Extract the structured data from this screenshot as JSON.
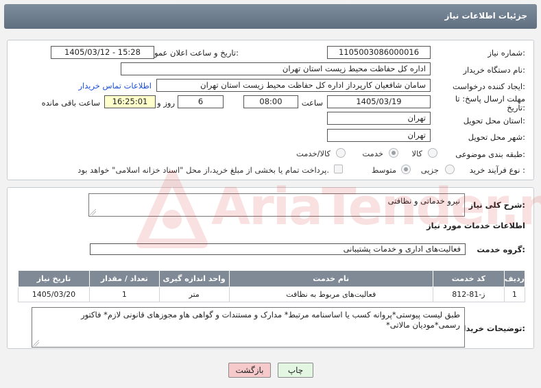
{
  "header": {
    "title": "جزئیات اطلاعات نیاز"
  },
  "form": {
    "need_number_label": "شماره نیاز:",
    "need_number": "1105003086000016",
    "announce_label": "تاریخ و ساعت اعلان عمومی:",
    "announce_value": "1405/03/12 - 15:28",
    "buyer_org_label": "نام دستگاه خریدار:",
    "buyer_org": "اداره کل حفاظت محیط زیست استان تهران",
    "requester_label": "ایجاد کننده درخواست:",
    "requester": "سامان شافعیان کارپرداز اداره کل حفاظت محیط زیست استان تهران",
    "contact_link": "اطلاعات تماس خریدار",
    "deadline_label_1": "مهلت ارسال پاسخ: تا",
    "deadline_label_2": "تاریخ:",
    "deadline_date": "1405/03/19",
    "time_label": "ساعت",
    "deadline_time": "08:00",
    "days_value": "6",
    "days_label": "روز و",
    "remaining_time": "16:25:01",
    "remaining_label": "ساعت باقی مانده",
    "province_label": "استان محل تحویل:",
    "province": "تهران",
    "city_label": "شهر محل تحویل:",
    "city": "تهران",
    "category_label": "طبقه بندی موضوعی:",
    "category_options": [
      "کالا",
      "خدمت",
      "کالا/خدمت"
    ],
    "process_label": "نوع فرآیند خرید :",
    "process_options": [
      "جزیی",
      "متوسط"
    ],
    "payment_note": "پرداخت تمام یا بخشی از مبلغ خرید،از محل \"اسناد خزانه اسلامی\" خواهد بود."
  },
  "description": {
    "label": "شرح کلی نیاز:",
    "value": "نیرو خدماتی و نظافتی"
  },
  "services": {
    "section_title": "اطلاعات خدمات مورد نیاز",
    "group_label": "گروه خدمت:",
    "group_value": "فعالیت‌های اداری و خدمات پشتیبانی",
    "columns": [
      "ردیف",
      "کد خدمت",
      "نام خدمت",
      "واحد اندازه گیری",
      "تعداد / مقدار",
      "تاریخ نیاز"
    ],
    "rows": [
      [
        "1",
        "ز-81-812",
        "فعالیت‌های مربوط به نظافت",
        "متر",
        "1",
        "1405/03/20"
      ]
    ]
  },
  "buyer_notes": {
    "label": "توضیحات خریدار:",
    "value": "طبق لیست پیوستی*پروانه کسب یا اساسنامه مرتبط* مدارک و مستندات و گواهی هاو مجوزهای قانونی لازم* فاکتور رسمی*مودیان مالاتی*"
  },
  "buttons": {
    "print": "چاپ",
    "back": "بازگشت"
  },
  "watermark": {
    "text": "AriaTender.net"
  },
  "colors": {
    "header": "#6b7a8a",
    "table_header": "#7f8a96",
    "link": "#1a4fd8",
    "back_button": "#f6caca",
    "print_button": "#e2f6e2"
  }
}
